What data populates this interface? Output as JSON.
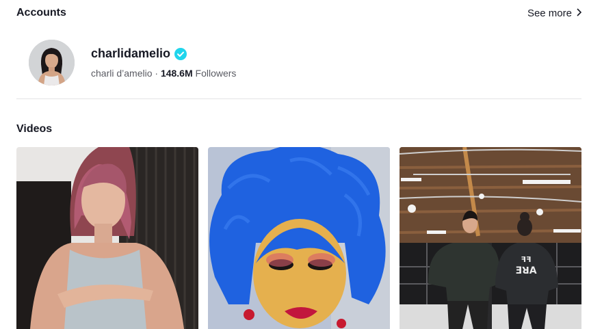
{
  "accounts": {
    "title": "Accounts",
    "see_more_label": "See more",
    "items": [
      {
        "username": "charlidamelio",
        "display_name": "charli d’amelio",
        "separator": "·",
        "follower_count": "148.6M",
        "follower_label": "Followers",
        "verified": true
      }
    ]
  },
  "videos": {
    "title": "Videos",
    "items": [
      {
        "thumbnail": "girl-with-pink-hair-dancing"
      },
      {
        "thumbnail": "person-in-blue-wig"
      },
      {
        "thumbnail": "two-people-in-hoodies-dance-studio"
      }
    ]
  },
  "colors": {
    "verified": "#20d5ec",
    "text_primary": "#161823",
    "divider": "#e3e3e4"
  }
}
